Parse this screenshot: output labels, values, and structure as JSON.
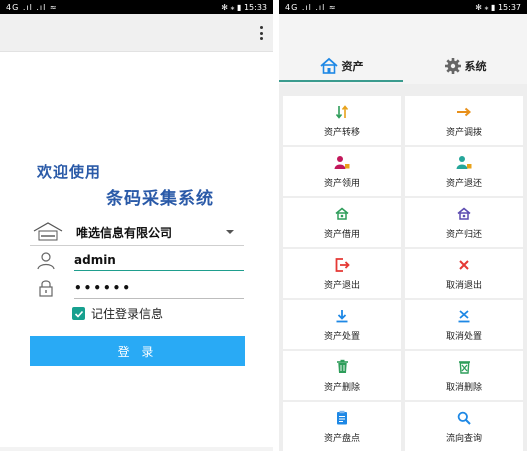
{
  "left_phone": {
    "status_left": "4G .ıl .ıl ≈",
    "status_right": "✻ ⁎ ▮ 15:33",
    "welcome_line1": "欢迎使用",
    "welcome_line2": "条码采集系统",
    "company": {
      "logo_icon": "house-logo-icon",
      "selected": "唯选信息有限公司",
      "caret_icon": "chevron-down-icon"
    },
    "username": {
      "icon": "user-icon",
      "value": "admin"
    },
    "password": {
      "icon": "lock-icon",
      "value": "••••••"
    },
    "remember": {
      "checked": true,
      "label": "记住登录信息"
    },
    "login_label": "登 录"
  },
  "right_phone": {
    "status_left": "4G .ıl .ıl ≈",
    "status_right": "✻ ⁎ ▮ 15:37",
    "tabs": [
      {
        "label": "资产",
        "icon": "house-icon",
        "active": true
      },
      {
        "label": "系统",
        "icon": "gear-icon",
        "active": false
      }
    ],
    "menu": [
      {
        "label": "资产转移",
        "icon": "transfer-icon",
        "color": "#e8a21a"
      },
      {
        "label": "资产调拨",
        "icon": "arrow-right-icon",
        "color": "#e8901a"
      },
      {
        "label": "资产领用",
        "icon": "user-receive-icon",
        "color": "#c2185b"
      },
      {
        "label": "资产退还",
        "icon": "user-return-icon",
        "color": "#26a69a"
      },
      {
        "label": "资产借用",
        "icon": "house-borrow-icon",
        "color": "#2e9d5a"
      },
      {
        "label": "资产归还",
        "icon": "house-return-icon",
        "color": "#5c4bb0"
      },
      {
        "label": "资产退出",
        "icon": "exit-icon",
        "color": "#e53935"
      },
      {
        "label": "取消退出",
        "icon": "cancel-icon",
        "color": "#e53935"
      },
      {
        "label": "资产处置",
        "icon": "download-icon",
        "color": "#1e88e5"
      },
      {
        "label": "取消处置",
        "icon": "cancel-dispose-icon",
        "color": "#1e88e5"
      },
      {
        "label": "资产删除",
        "icon": "trash-icon",
        "color": "#2e9d5a"
      },
      {
        "label": "取消删除",
        "icon": "cancel-delete-icon",
        "color": "#2e9d5a"
      },
      {
        "label": "资产盘点",
        "icon": "clipboard-icon",
        "color": "#1e88e5"
      },
      {
        "label": "流向查询",
        "icon": "search-icon",
        "color": "#1e88e5"
      }
    ]
  }
}
